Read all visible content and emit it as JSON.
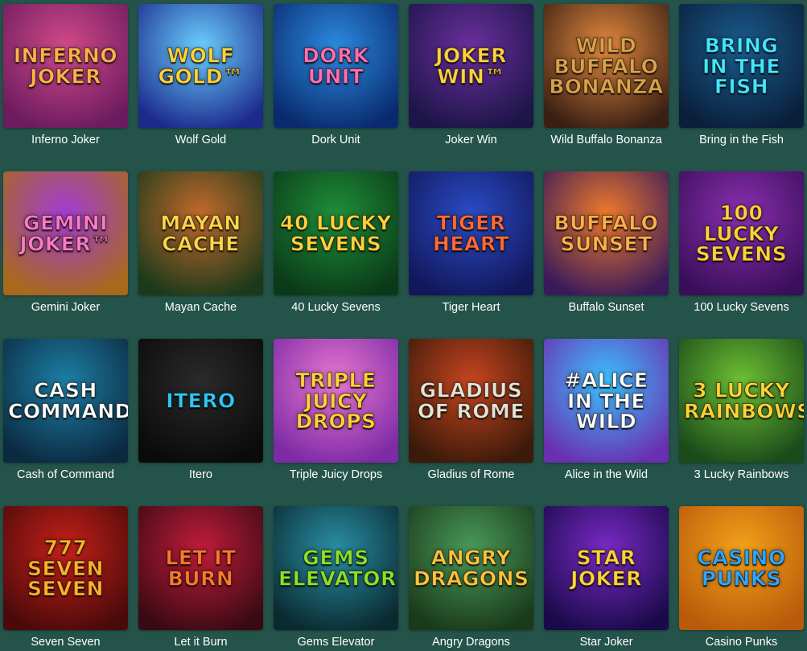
{
  "games": [
    {
      "title": "Inferno Joker",
      "logo": "Inferno\nJoker",
      "bg": [
        "#d14a8a",
        "#6b1b5e"
      ],
      "logo_color": "#ffb14a"
    },
    {
      "title": "Wolf Gold",
      "logo": "Wolf\nGold™",
      "bg": [
        "#6ad0ff",
        "#1c2a8c"
      ],
      "logo_color": "#ffd23a"
    },
    {
      "title": "Dork Unit",
      "logo": "Dork\nUnit",
      "bg": [
        "#2b8be0",
        "#0a2a6e"
      ],
      "logo_color": "#ff6fb0"
    },
    {
      "title": "Joker Win",
      "logo": "Joker\nWin™",
      "bg": [
        "#6b2f9e",
        "#1c1547"
      ],
      "logo_color": "#ffd13c"
    },
    {
      "title": "Wild Buffalo Bonanza",
      "logo": "Wild Buffalo\nBonanza",
      "bg": [
        "#e58a3e",
        "#3a2014"
      ],
      "logo_color": "#d9a24a"
    },
    {
      "title": "Bring in the Fish",
      "logo": "Bring\nin the\nFish",
      "bg": [
        "#1b5c8f",
        "#0a1f3a"
      ],
      "logo_color": "#43e6ff"
    },
    {
      "title": "Gemini Joker",
      "logo": "Gemini\nJoker™",
      "bg": [
        "#a23bd6",
        "#a86a1a"
      ],
      "logo_color": "#ff7ac6"
    },
    {
      "title": "Mayan Cache",
      "logo": "Mayan\nCache",
      "bg": [
        "#c46a2c",
        "#1c3a1a"
      ],
      "logo_color": "#ffd54a"
    },
    {
      "title": "40 Lucky Sevens",
      "logo": "40 Lucky\nSevens",
      "bg": [
        "#1e8f3a",
        "#0b3a18"
      ],
      "logo_color": "#ffd23a"
    },
    {
      "title": "Tiger Heart",
      "logo": "Tiger\nHeart",
      "bg": [
        "#2a4cc6",
        "#12175a"
      ],
      "logo_color": "#ff6a3a"
    },
    {
      "title": "Buffalo Sunset",
      "logo": "Buffalo\nSunset",
      "bg": [
        "#f07a2a",
        "#3a1a5a"
      ],
      "logo_color": "#ffb04a"
    },
    {
      "title": "100 Lucky Sevens",
      "logo": "100 Lucky\nSevens",
      "bg": [
        "#8c2fb0",
        "#3a0f5a"
      ],
      "logo_color": "#ffd23a"
    },
    {
      "title": "Cash of Command",
      "logo": "Cash\nCommand",
      "bg": [
        "#1d7fa6",
        "#0b2a40"
      ],
      "logo_color": "#ffffff"
    },
    {
      "title": "Itero",
      "logo": "Itero",
      "bg": [
        "#2a2a2a",
        "#0a0a0a"
      ],
      "logo_color": "#2fc8f2"
    },
    {
      "title": "Triple Juicy Drops",
      "logo": "Triple\nJuicy\nDrops",
      "bg": [
        "#e978d0",
        "#7c2aa6"
      ],
      "logo_color": "#ffd23a"
    },
    {
      "title": "Gladius of Rome",
      "logo": "Gladius\nof Rome",
      "bg": [
        "#c9451f",
        "#3a1a0a"
      ],
      "logo_color": "#e7e3d4"
    },
    {
      "title": "Alice in the Wild",
      "logo": "#Alice\nin the Wild",
      "bg": [
        "#3ac3ff",
        "#6a2fb0"
      ],
      "logo_color": "#ffffff"
    },
    {
      "title": "3 Lucky Rainbows",
      "logo": "3 Lucky\nRainbows",
      "bg": [
        "#6ec232",
        "#1a4a1a"
      ],
      "logo_color": "#ffd23a"
    },
    {
      "title": "Seven Seven",
      "logo": "777\nSeven Seven",
      "bg": [
        "#c6201a",
        "#4a0a0a"
      ],
      "logo_color": "#ffb02a"
    },
    {
      "title": "Let it Burn",
      "logo": "Let It\nBurn",
      "bg": [
        "#c21c3a",
        "#3a0a14"
      ],
      "logo_color": "#ff7a2a"
    },
    {
      "title": "Gems Elevator",
      "logo": "Gems\nElevator",
      "bg": [
        "#2a8fa6",
        "#0a2a30"
      ],
      "logo_color": "#8de02a"
    },
    {
      "title": "Angry Dragons",
      "logo": "Angry\nDragons",
      "bg": [
        "#4a9a5a",
        "#1a3a1a"
      ],
      "logo_color": "#ffc23a"
    },
    {
      "title": "Star Joker",
      "logo": "Star Joker",
      "bg": [
        "#7a2ac6",
        "#1a0a4a"
      ],
      "logo_color": "#ffd23a"
    },
    {
      "title": "Casino Punks",
      "logo": "Casino\nPunks",
      "bg": [
        "#f2a21a",
        "#b85a0a"
      ],
      "logo_color": "#2fa6ff"
    }
  ]
}
